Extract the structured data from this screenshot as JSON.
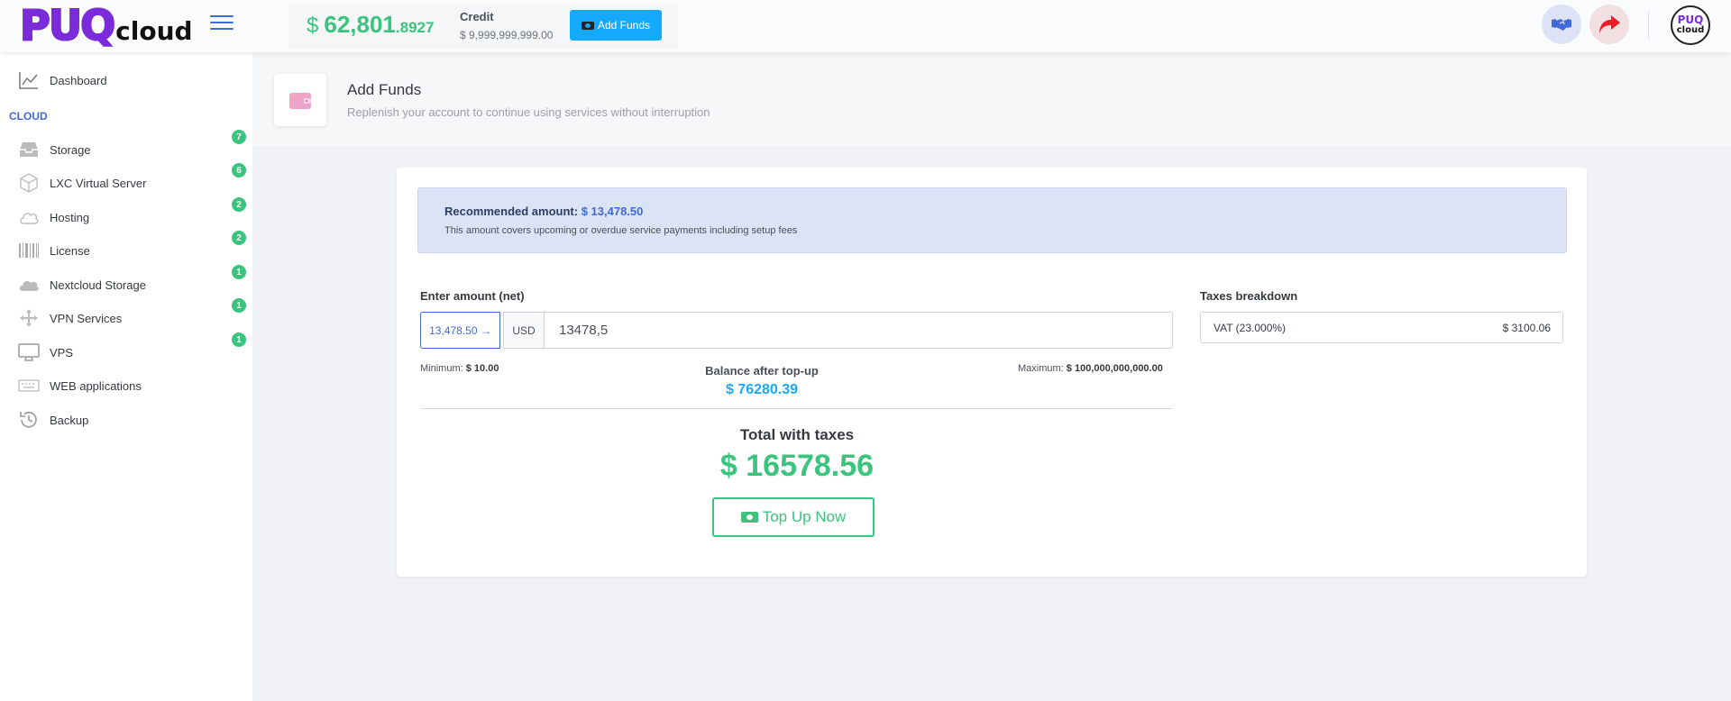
{
  "header": {
    "logo_main": "PUQ",
    "logo_sub": "cloud",
    "balance_currency": "$",
    "balance_int": "62,801",
    "balance_dec": ".8927",
    "credit_label": "Credit",
    "credit_value": "$ 9,999,999,999.00",
    "add_funds_label": "Add Funds",
    "avatar_line1": "PUQ",
    "avatar_line2": "cloud"
  },
  "sidebar": {
    "section_label": "CLOUD",
    "items": [
      {
        "label": "Dashboard",
        "icon": "chart-line-icon"
      },
      {
        "label": "Storage",
        "icon": "inbox-icon",
        "badge": "7"
      },
      {
        "label": "LXC Virtual Server",
        "icon": "cube-icon",
        "badge": "6"
      },
      {
        "label": "Hosting",
        "icon": "cloud-outline-icon",
        "badge": "2"
      },
      {
        "label": "License",
        "icon": "barcode-icon",
        "badge": "2"
      },
      {
        "label": "Nextcloud Storage",
        "icon": "cloud-icon",
        "badge": "1"
      },
      {
        "label": "VPN Services",
        "icon": "arrows-icon",
        "badge": "1"
      },
      {
        "label": "VPS",
        "icon": "monitor-icon",
        "badge": "1"
      },
      {
        "label": "WEB applications",
        "icon": "keyboard-icon"
      },
      {
        "label": "Backup",
        "icon": "history-icon"
      }
    ]
  },
  "page": {
    "title": "Add Funds",
    "subtitle": "Replenish your account to continue using services without interruption"
  },
  "alert": {
    "title_prefix": "Recommended amount:",
    "title_amount": "$ 13,478.50",
    "subtitle": "This amount covers upcoming or overdue service payments including setup fees"
  },
  "form": {
    "enter_label": "Enter amount (net)",
    "preset_amount": "13,478.50",
    "currency": "USD",
    "amount_value": "13478,5",
    "min_label": "Minimum:",
    "min_value": "$ 10.00",
    "max_label": "Maximum:",
    "max_value": "$ 100,000,000,000.00",
    "balance_after_label": "Balance after top-up",
    "balance_after_value": "$ 76280.39",
    "total_label": "Total with taxes",
    "total_value": "$ 16578.56",
    "topup_label": "Top Up Now"
  },
  "taxes": {
    "label": "Taxes breakdown",
    "rows": [
      {
        "name": "VAT (23.000%)",
        "value": "$ 3100.06"
      }
    ]
  },
  "colors": {
    "primary": "#3f6ad8",
    "success": "#3ac47d",
    "info": "#16aaff",
    "brand": "#7a2bdc"
  }
}
